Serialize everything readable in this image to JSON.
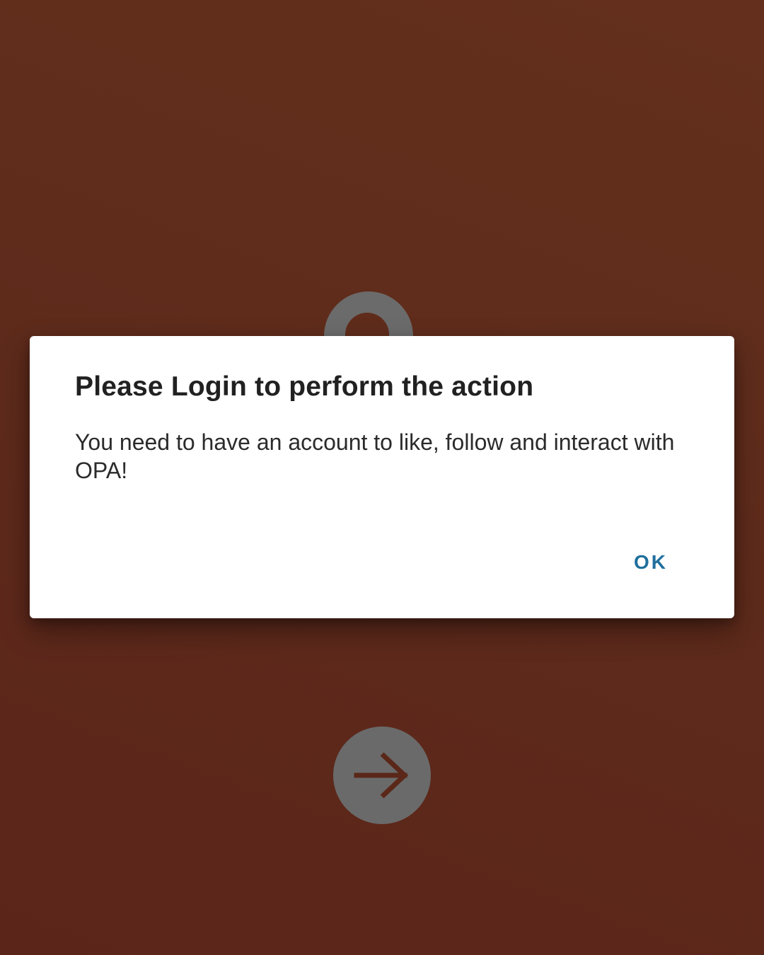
{
  "background": {
    "color": "#5f2b1b"
  },
  "avatar": {
    "icon": "user-avatar-icon"
  },
  "next_button": {
    "icon": "arrow-right-icon",
    "color": "#6a6a6a",
    "arrow_color": "#5a2718"
  },
  "dialog": {
    "title": "Please Login to perform the action",
    "message": "You need to have an account to like, follow and interact with OPA!",
    "ok_label": "OK",
    "accent_color": "#1f6f9d"
  }
}
